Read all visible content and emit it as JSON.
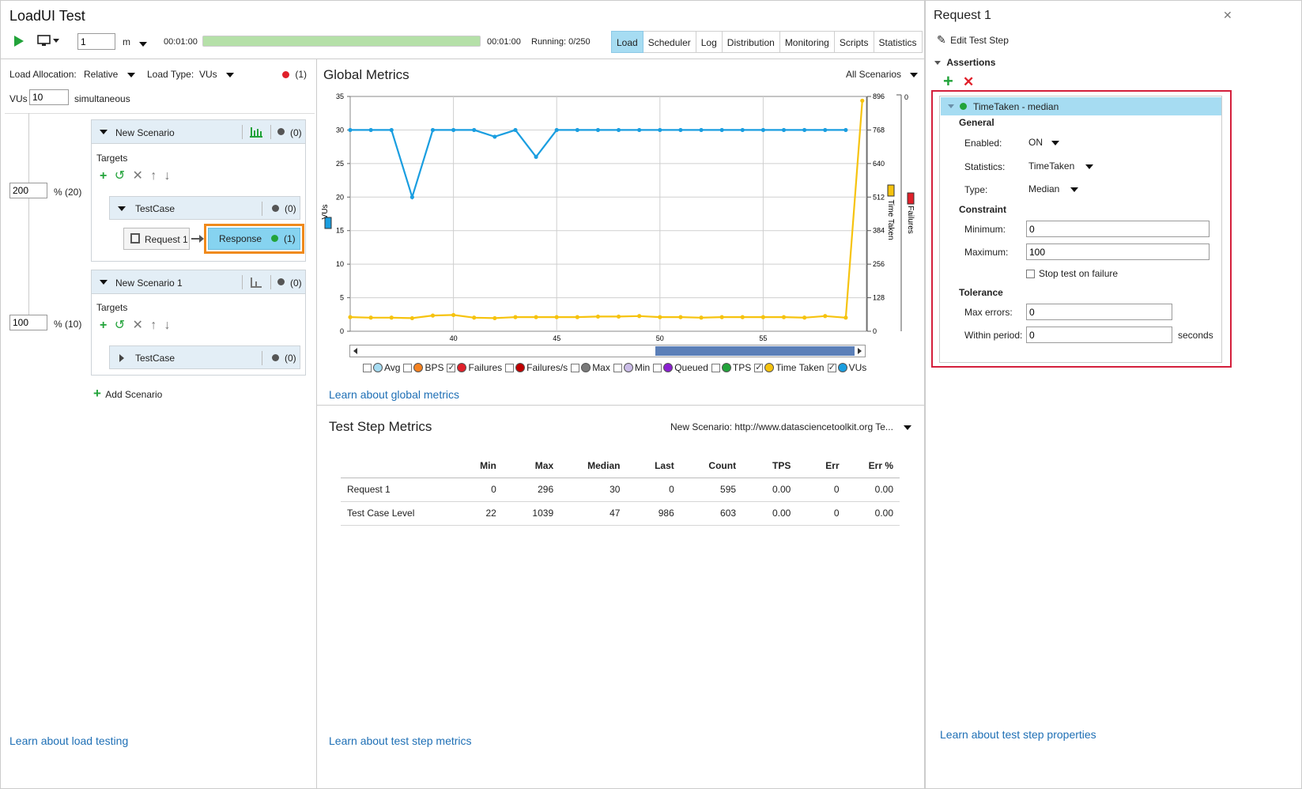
{
  "app": {
    "title": "LoadUI Test",
    "duration_value": "1",
    "duration_unit": "m",
    "elapsed": "00:01:00",
    "total": "00:01:00",
    "running": "Running: 0/250",
    "progress_pct": 100
  },
  "tabs": [
    "Load",
    "Scheduler",
    "Log",
    "Distribution",
    "Monitoring",
    "Scripts",
    "Statistics"
  ],
  "active_tab": "Load",
  "left": {
    "load_allocation_label": "Load Allocation:",
    "load_allocation_value": "Relative",
    "load_type_label": "Load Type:",
    "load_type_value": "VUs",
    "error_count": "(1)",
    "vus_label": "VUs",
    "vus_value": "10",
    "vus_suffix": "simultaneous",
    "scenarios": [
      {
        "name": "New Scenario",
        "count": "(0)",
        "weight": "200",
        "weight_pct": "% (20)",
        "targets_label": "Targets",
        "testcase": "TestCase",
        "testcase_count": "(0)",
        "request": "Request 1",
        "assertion": "Response",
        "assertion_count": "(1)"
      },
      {
        "name": "New Scenario 1",
        "count": "(0)",
        "weight": "100",
        "weight_pct": "% (10)",
        "targets_label": "Targets",
        "testcase": "TestCase",
        "testcase_count": "(0)"
      }
    ],
    "add_scenario": "Add Scenario",
    "learn_link": "Learn about load testing"
  },
  "global_metrics": {
    "title": "Global Metrics",
    "scope": "All Scenarios",
    "learn_link": "Learn about global metrics"
  },
  "legend": [
    {
      "label": "Avg",
      "color": "#a6dcf2",
      "checked": false
    },
    {
      "label": "BPS",
      "color": "#f58220",
      "checked": false
    },
    {
      "label": "Failures",
      "color": "#e0202a",
      "checked": true
    },
    {
      "label": "Failures/s",
      "color": "#c00000",
      "checked": false
    },
    {
      "label": "Max",
      "color": "#7a7a7a",
      "checked": false
    },
    {
      "label": "Min",
      "color": "#cbbde8",
      "checked": false
    },
    {
      "label": "Queued",
      "color": "#8a1fd0",
      "checked": false
    },
    {
      "label": "TPS",
      "color": "#22a33a",
      "checked": false
    },
    {
      "label": "Time Taken",
      "color": "#f6c30f",
      "checked": true
    },
    {
      "label": "VUs",
      "color": "#1a9ee0",
      "checked": true
    }
  ],
  "chart_data": {
    "type": "line",
    "x_ticks": [
      "40",
      "45",
      "50",
      "55"
    ],
    "xlim": [
      35,
      60
    ],
    "y_left": {
      "label": "VUs",
      "ticks": [
        "0",
        "5",
        "10",
        "15",
        "20",
        "25",
        "30",
        "35"
      ],
      "ylim": [
        0,
        35
      ]
    },
    "y_right": {
      "label": "Time Taken",
      "ticks": [
        "0",
        "128",
        "256",
        "384",
        "512",
        "640",
        "768",
        "896"
      ],
      "ylim": [
        0,
        896
      ]
    },
    "y_right2": {
      "label": "Failures",
      "ticks": [
        "0"
      ]
    },
    "series": [
      {
        "name": "VUs",
        "color": "#1a9ee0",
        "x": [
          35,
          36,
          37,
          38,
          39,
          40,
          41,
          42,
          43,
          44,
          45,
          46,
          47,
          48,
          49,
          50,
          51,
          52,
          53,
          54,
          55,
          56,
          57,
          58,
          59
        ],
        "values": [
          30,
          30,
          30,
          20,
          30,
          30,
          30,
          29,
          30,
          26,
          30,
          30,
          30,
          30,
          30,
          30,
          30,
          30,
          30,
          30,
          30,
          30,
          30,
          30,
          30
        ]
      },
      {
        "name": "Time Taken",
        "color": "#f6c30f",
        "x": [
          35,
          36,
          37,
          38,
          39,
          40,
          41,
          42,
          43,
          44,
          45,
          46,
          47,
          48,
          49,
          50,
          51,
          52,
          53,
          54,
          55,
          56,
          57,
          58,
          59,
          59.8
        ],
        "values": [
          54,
          52,
          52,
          50,
          60,
          62,
          52,
          50,
          54,
          54,
          54,
          54,
          56,
          56,
          58,
          54,
          54,
          52,
          54,
          54,
          54,
          54,
          52,
          58,
          52,
          880
        ]
      }
    ]
  },
  "step_metrics": {
    "title": "Test Step Metrics",
    "scope": "New Scenario: http://www.datasciencetoolkit.org Te...",
    "columns": [
      "",
      "Min",
      "Max",
      "Median",
      "Last",
      "Count",
      "TPS",
      "Err",
      "Err %"
    ],
    "rows": [
      [
        "Request 1",
        "0",
        "296",
        "30",
        "0",
        "595",
        "0.00",
        "0",
        "0.00"
      ],
      [
        "Test Case Level",
        "22",
        "1039",
        "47",
        "986",
        "603",
        "0.00",
        "0",
        "0.00"
      ]
    ],
    "learn_link": "Learn about test step metrics"
  },
  "right": {
    "title": "Request 1",
    "edit_step": "Edit Test Step",
    "assertions_label": "Assertions",
    "assertion_name": "TimeTaken - median",
    "general_label": "General",
    "enabled_label": "Enabled:",
    "enabled_value": "ON",
    "statistics_label": "Statistics:",
    "statistics_value": "TimeTaken",
    "type_label": "Type:",
    "type_value": "Median",
    "constraint_label": "Constraint",
    "minimum_label": "Minimum:",
    "minimum_value": "0",
    "maximum_label": "Maximum:",
    "maximum_value": "100",
    "stop_on_failure": "Stop test on failure",
    "tolerance_label": "Tolerance",
    "max_errors_label": "Max errors:",
    "max_errors_value": "0",
    "within_label": "Within period:",
    "within_value": "0",
    "within_unit": "seconds",
    "learn_link": "Learn about test step properties"
  }
}
